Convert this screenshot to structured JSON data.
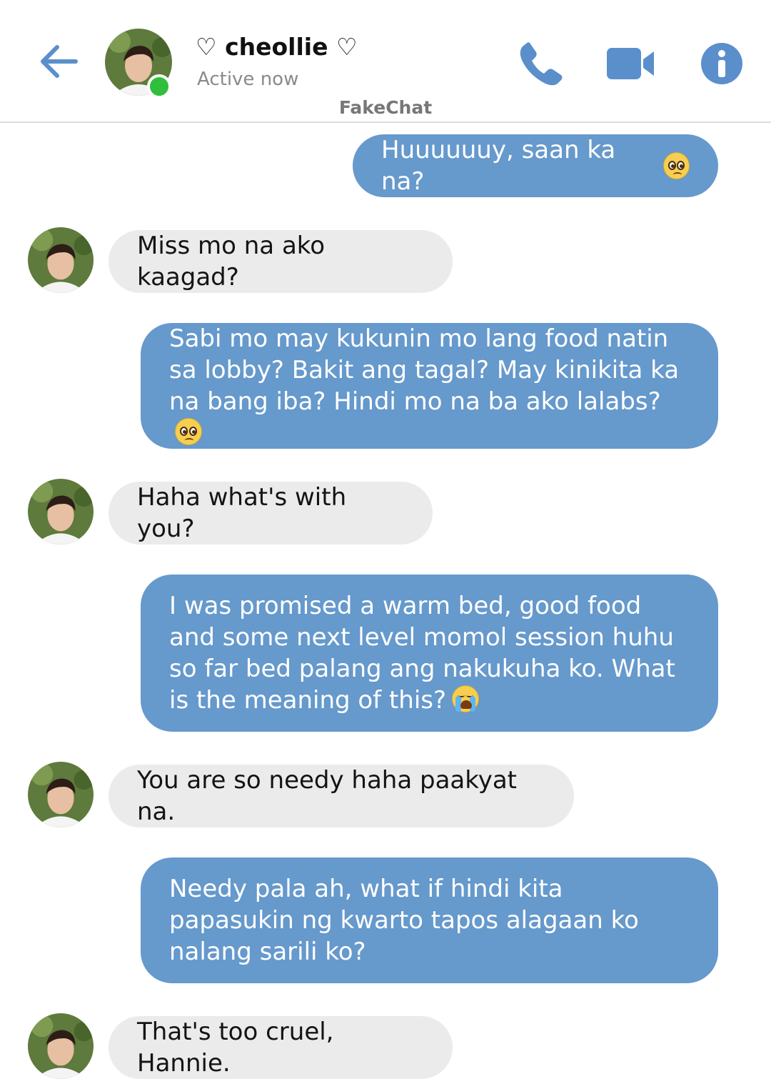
{
  "header": {
    "contact_name": "♡ cheollie ♡",
    "status": "Active now",
    "app_label": "FakeChat",
    "icons": [
      "back-arrow-icon",
      "phone-icon",
      "video-camera-icon",
      "info-icon"
    ],
    "accent_color": "#5b8fcb",
    "online_color": "#2fbf3a"
  },
  "messages": [
    {
      "sender": "me",
      "text": "Huuuuuuy, saan ka na?",
      "emoji": "pleading-face"
    },
    {
      "sender": "contact",
      "text": "Miss mo na ako kaagad?"
    },
    {
      "sender": "me",
      "text": "Sabi mo may kukunin mo lang food natin sa lobby? Bakit ang tagal? May kinikita ka na bang iba? Hindi mo na ba ako lalabs?",
      "emoji": "pleading-face"
    },
    {
      "sender": "contact",
      "text": "Haha what's with you?"
    },
    {
      "sender": "me",
      "text": "I was promised a warm bed, good food and some next level momol session huhu so far bed palang ang nakukuha ko. What is the meaning of this?",
      "emoji": "loudly-crying-face"
    },
    {
      "sender": "contact",
      "text": "You are so needy haha paakyat na."
    },
    {
      "sender": "me",
      "text": "Needy pala ah, what if hindi kita papasukin ng kwarto tapos alagaan ko nalang sarili ko?"
    },
    {
      "sender": "contact",
      "text": "That's too cruel, Hannie."
    }
  ],
  "colors": {
    "outgoing_bubble": "#6699cc",
    "incoming_bubble": "#ebebeb"
  }
}
